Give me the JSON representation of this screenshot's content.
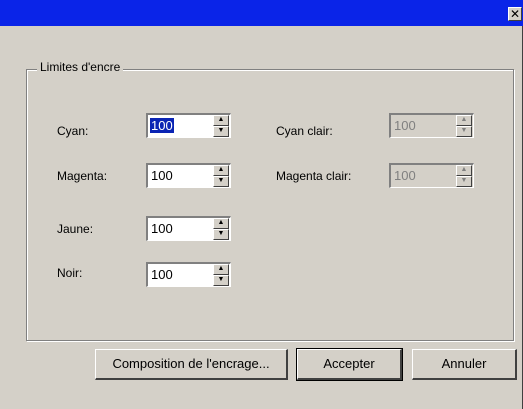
{
  "titlebar": {
    "close_glyph": "✕"
  },
  "group": {
    "title": "Limites d'encre"
  },
  "fields": {
    "cyan": {
      "label": "Cyan:",
      "value": "100"
    },
    "magenta": {
      "label": "Magenta:",
      "value": "100"
    },
    "jaune": {
      "label": "Jaune:",
      "value": "100"
    },
    "noir": {
      "label": "Noir:",
      "value": "100"
    },
    "cyan_clair": {
      "label": "Cyan clair:",
      "value": "100"
    },
    "magenta_clair": {
      "label": "Magenta clair:",
      "value": "100"
    }
  },
  "buttons": {
    "composition": "Composition de l'encrage...",
    "accept": "Accepter",
    "cancel": "Annuler"
  },
  "colors": {
    "titlebar": "#0a24e8",
    "face": "#d4d0c8",
    "selection": "#0a24b4"
  }
}
